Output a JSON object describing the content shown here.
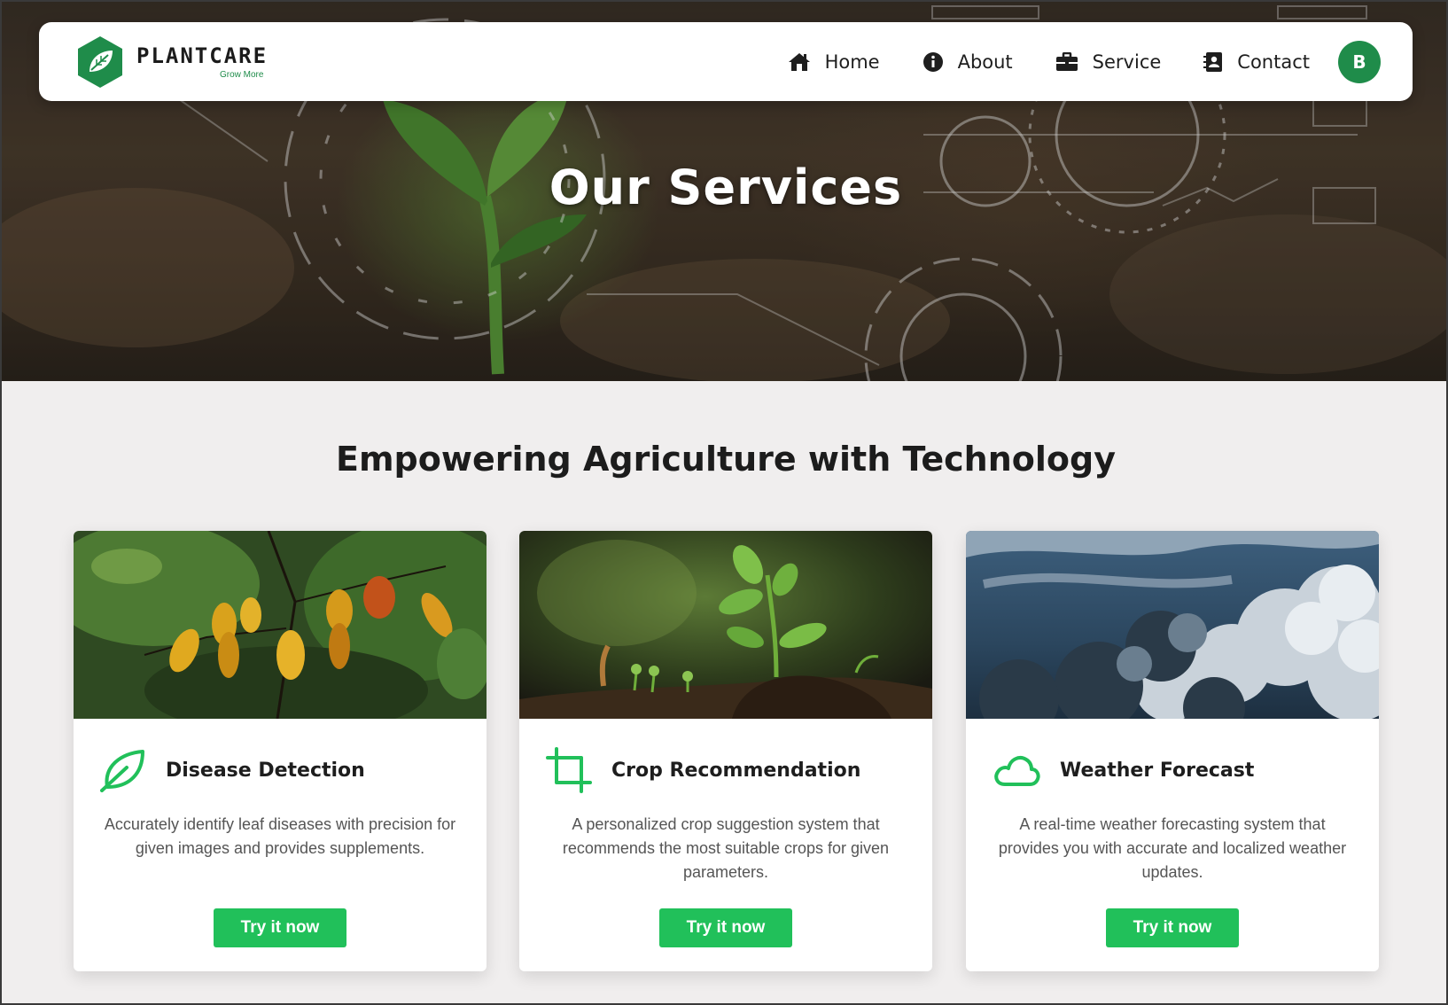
{
  "brand": {
    "name": "PLANTCARE",
    "tagline": "Grow More"
  },
  "nav": {
    "items": [
      {
        "label": "Home",
        "icon": "home-icon"
      },
      {
        "label": "About",
        "icon": "info-icon"
      },
      {
        "label": "Service",
        "icon": "briefcase-icon"
      },
      {
        "label": "Contact",
        "icon": "contact-icon"
      }
    ],
    "avatar_initial": "B"
  },
  "hero": {
    "title": "Our Services"
  },
  "section": {
    "title": "Empowering Agriculture with Technology"
  },
  "cards": [
    {
      "title": "Disease Detection",
      "icon": "leaf-icon",
      "description": "Accurately identify leaf diseases with precision for given images and provides supplements.",
      "button": "Try it now"
    },
    {
      "title": "Crop Recommendation",
      "icon": "crop-icon",
      "description": "A personalized crop suggestion system that recommends the most suitable crops for given parameters.",
      "button": "Try it now"
    },
    {
      "title": "Weather Forecast",
      "icon": "cloud-icon",
      "description": "A real-time weather forecasting system that provides you with accurate and localized weather updates.",
      "button": "Try it now"
    }
  ],
  "colors": {
    "brand_green": "#1f8c4a",
    "button_green": "#21c05a",
    "icon_green": "#21c05a"
  }
}
